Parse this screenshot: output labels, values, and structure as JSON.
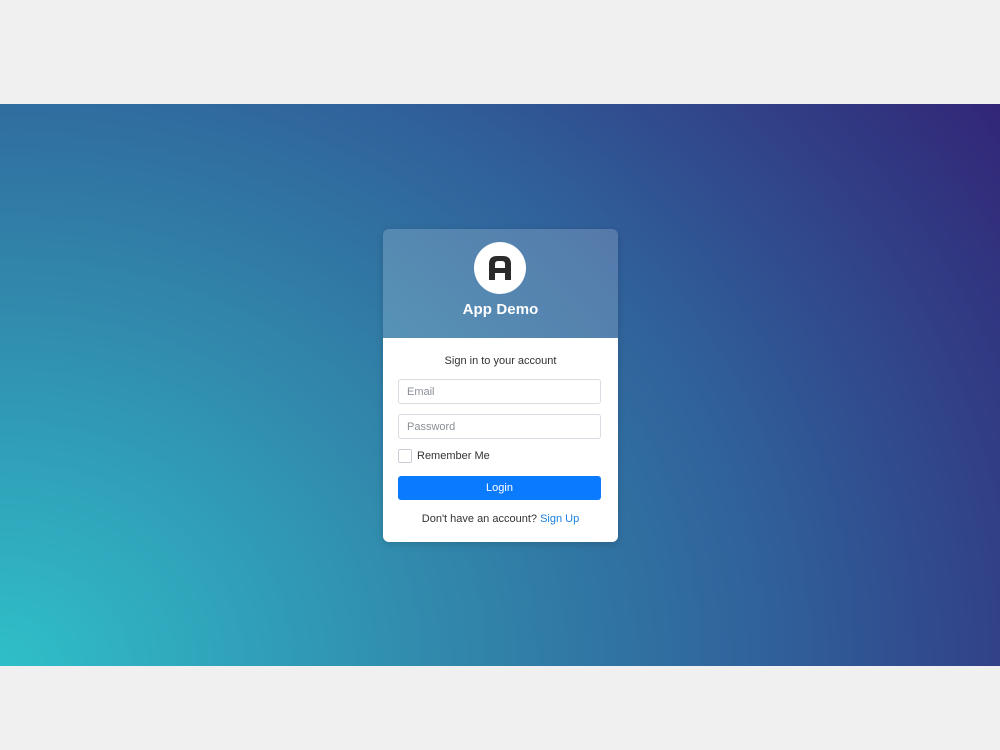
{
  "app": {
    "title": "App Demo",
    "logo_icon": "letter-a-logo-icon"
  },
  "login_form": {
    "subtitle": "Sign in to your account",
    "email_placeholder": "Email",
    "email_value": "",
    "password_placeholder": "Password",
    "password_value": "",
    "remember_label": "Remember Me",
    "remember_checked": false,
    "login_label": "Login",
    "signup_prompt": "Don't have an account?",
    "signup_link": "Sign Up"
  },
  "colors": {
    "primary_button": "#0a7bff",
    "link": "#1a7fe0",
    "gradient_start": "#2fbfc9",
    "gradient_end": "#321f74"
  }
}
